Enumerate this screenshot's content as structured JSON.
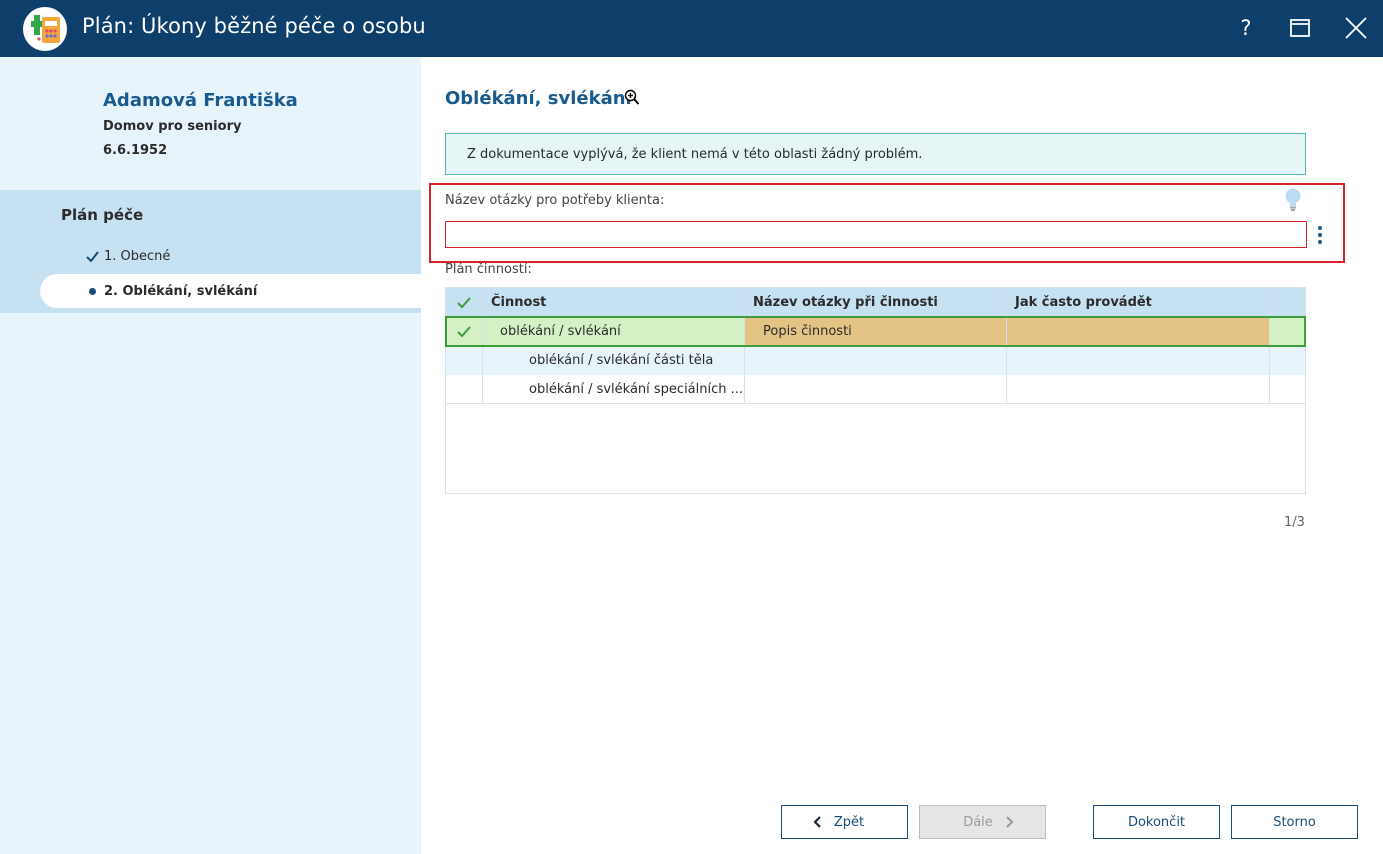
{
  "window": {
    "title": "Plán: Úkony běžné péče o osobu",
    "help_label": "?"
  },
  "client": {
    "name": "Adamová Františka",
    "facility": "Domov pro seniory",
    "birth_date": "6.6.1952"
  },
  "nav": {
    "title": "Plán péče",
    "items": [
      {
        "label": "1. Obecné",
        "state": "done"
      },
      {
        "label": "2. Oblékání, svlékání",
        "state": "current"
      }
    ]
  },
  "section": {
    "heading": "Oblékání, svlékání",
    "info": "Z dokumentace vyplývá, že klient nemá v této oblasti žádný problém.",
    "question_label": "Název otázky pro potřeby klienta:",
    "question_value": "",
    "plan_label": "Plán činností:"
  },
  "table": {
    "headers": [
      "Činnost",
      "Název otázky při činnosti",
      "Jak často provádět"
    ],
    "rows": [
      {
        "checked": true,
        "activity": "oblékání / svlékání",
        "question": "Popis činnosti",
        "frequency": ""
      },
      {
        "checked": false,
        "activity": "oblékání / svlékání části těla",
        "question": "",
        "frequency": ""
      },
      {
        "checked": false,
        "activity": "oblékání / svlékání speciálních ...",
        "question": "",
        "frequency": ""
      }
    ],
    "pager": "1/3"
  },
  "buttons": {
    "back": "Zpět",
    "next": "Dále",
    "finish": "Dokončit",
    "cancel": "Storno"
  },
  "colors": {
    "titlebar": "#0e3f6a",
    "accent": "#1a5a8c",
    "sidebar": "#e8f4fb",
    "nav_block": "#c6e1f2",
    "error": "#d9232a",
    "selected_row": "#d4f1c6",
    "highlight_cell": "#e4c484",
    "check": "#3f9c3c"
  },
  "icons": {
    "app": "medical-app-icon",
    "help": "help-icon",
    "maximize": "maximize-icon",
    "close": "close-icon",
    "hint": "lightbulb-icon",
    "more": "more-vertical-icon",
    "check": "check-icon"
  }
}
